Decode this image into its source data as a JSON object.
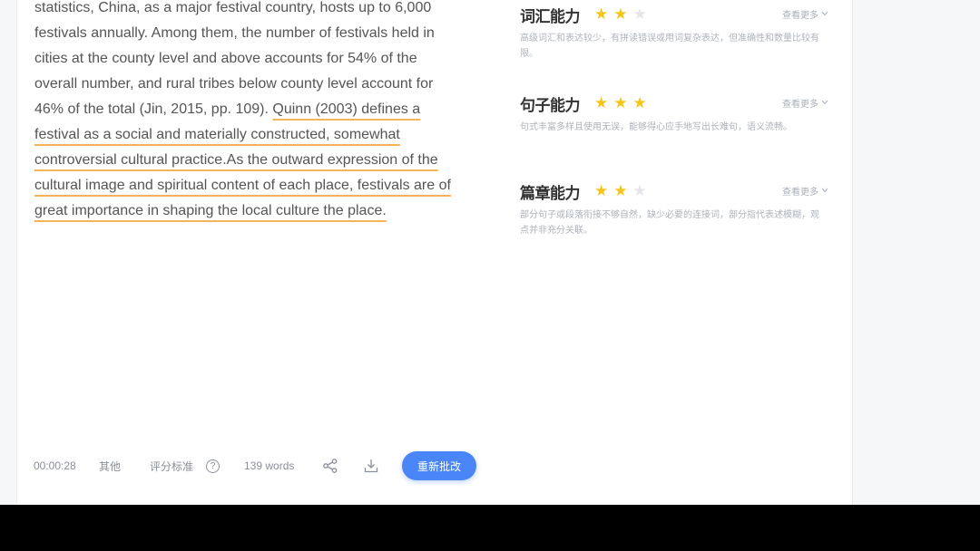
{
  "essay": {
    "lines": [
      "statistics, China, as a major festival country, hosts up to 6,000",
      "festivals annually. Among them, the number of festivals held in",
      "cities at the county level and above accounts for 54%  of the",
      "overall number, and rural tribes below  county level account for",
      "46%  of the total (Jin, 2015, pp. 109).",
      "Quinn (2003) defines a",
      "festival as a social and materially constructed, somewhat",
      "controversial cultural practice.As the outward expression of the",
      "cultural image and spiritual content of each place, festivals are of",
      "great importance in shaping the local culture  the place."
    ]
  },
  "footer": {
    "timer": "00:00:28",
    "other": "其他",
    "criteria": "评分标准",
    "help_glyph": "?",
    "word_count": "139 words",
    "share_icon": "share-icon",
    "download_icon": "download-icon",
    "submit_label": "重新批改",
    "accent_color": "#4a86f7"
  },
  "abilities": [
    {
      "title": "词汇能力",
      "stars_filled": 2,
      "stars_total": 3,
      "more_label": "查看更多",
      "description": "高级词汇和表达较少，有拼读错误或用词复杂表达，但准确性和数量比较有限。"
    },
    {
      "title": "句子能力",
      "stars_filled": 3,
      "stars_total": 3,
      "more_label": "查看更多",
      "description": "句式丰富多样且使用无误，能够得心应手地写出长难句，语义流畅。"
    },
    {
      "title": "篇章能力",
      "stars_filled": 2,
      "stars_total": 3,
      "more_label": "查看更多",
      "description": "部分句子或段落衔接不够自然，缺少必要的连接词，部分指代表述模糊，观点并非充分关联。"
    }
  ],
  "colors": {
    "star_on": "#f5c518",
    "star_off": "#e5e6ea",
    "underline": "#f2b35c"
  }
}
